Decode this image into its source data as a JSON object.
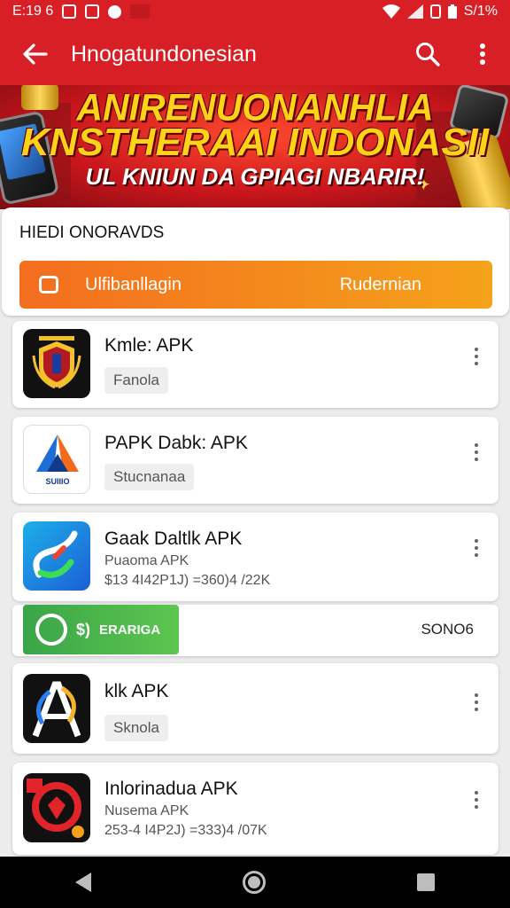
{
  "status_bar": {
    "time": "E:19 6",
    "battery": "S/1%"
  },
  "app_bar": {
    "title": "Hnogatundonesian",
    "back_icon": "arrow-left-icon",
    "search_icon": "search-icon",
    "menu_icon": "more-vert-icon"
  },
  "banner": {
    "line1": "ANIRENUONANHLIA",
    "line2": "KNSTHERAAI INDONASII",
    "line3": "UL KNIUN DA GPIAGI NBARIR!"
  },
  "top_card": {
    "label": "HIEDI ONORAVDS",
    "button_left": "Ulfibanllagin",
    "button_right": "Rudernian",
    "accent": "#f36d1f"
  },
  "items": [
    {
      "name": "Kmle: APK",
      "chip": "Fanola"
    },
    {
      "name": "PAPK Dabk: APK",
      "chip": "Stucnanaa"
    },
    {
      "name": "Gaak Daltlk APK",
      "sub1": "Puaoma APK",
      "sub2": "$13 4I42P1J) =360)4 /22K"
    },
    {
      "name": "klk APK",
      "chip": "Sknola"
    },
    {
      "name": "Inlorinadua APK",
      "sub1": "Nusema APK",
      "sub2": "253-4 I4P2J) =333)4 /07K"
    }
  ],
  "download_row": {
    "green_label": "ERARIGA",
    "right_text": "SONO6",
    "green_symbol": "$)"
  },
  "icon_labels": {
    "item2": "SUIIIO"
  },
  "colors": {
    "brand_red": "#d81f26",
    "green": "#3aa548"
  }
}
